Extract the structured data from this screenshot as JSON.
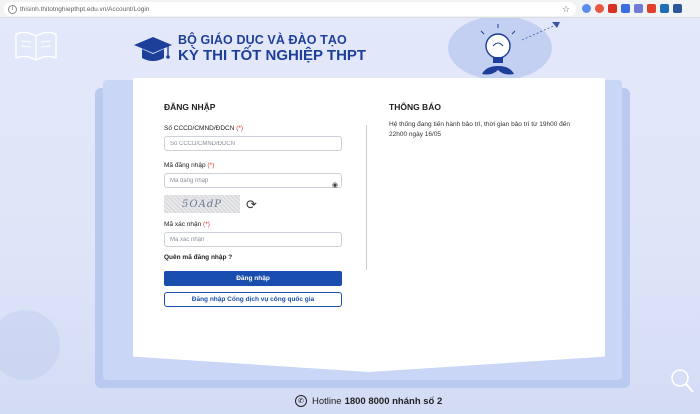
{
  "browser": {
    "url": "thisinh.thitotnghiepthpt.edu.vn/Account/Login",
    "ext_colors": [
      "#5b8def",
      "#e8563f",
      "#d93025",
      "#3b6ee0",
      "#6f7bd6",
      "#e0412e",
      "#1f6fb8",
      "#2b579a"
    ]
  },
  "header": {
    "subtitle": "BỘ GIÁO DỤC VÀ ĐÀO TẠO",
    "title": "KỲ THI TỐT NGHIỆP THPT"
  },
  "login": {
    "title": "ĐĂNG NHẬP",
    "id_label": "Số CCCD/CMND/ĐDCN",
    "id_required": "(*)",
    "id_placeholder": "Số CCCD/CMND/ĐDCN",
    "pw_label": "Mã đăng nhập",
    "pw_required": "(*)",
    "pw_placeholder": "Mã đăng nhập",
    "captcha_text": "5OAdP",
    "captcha_label": "Mã xác nhận",
    "captcha_required": "(*)",
    "captcha_placeholder": "Mã xác nhận",
    "forgot": "Quên mã đăng nhập ?",
    "submit": "Đăng nhập",
    "national_portal": "Đăng nhập Cổng dịch vụ công quốc gia"
  },
  "notice": {
    "title": "THÔNG BÁO",
    "text": "Hệ thống đang tiến hành bảo trì, thời gian bảo trì từ 19h00 đến 22h00 ngày 16/05"
  },
  "footer": {
    "hotline_label": "Hotline",
    "hotline_number": "1800 8000 nhánh số 2"
  },
  "colors": {
    "brand": "#1d3f9a",
    "button": "#1a4eae",
    "required": "#e0312e"
  }
}
